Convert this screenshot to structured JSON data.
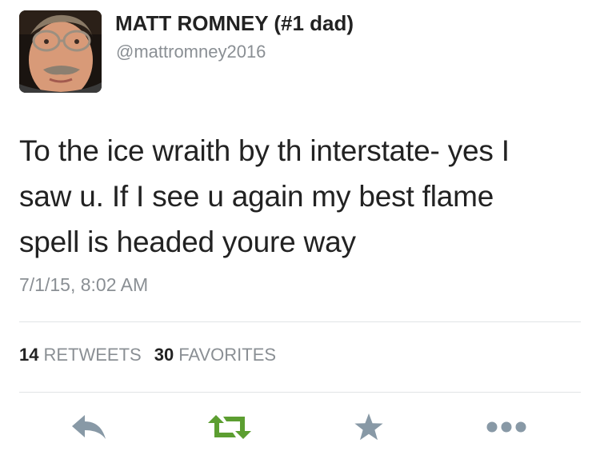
{
  "user": {
    "display_name": "MATT ROMNEY (#1 dad)",
    "handle": "@mattromney2016",
    "avatar": "profile-photo"
  },
  "tweet": {
    "text_lines": [
      "To the ice wraith by th interstate- yes I",
      "saw u. If I see u again my best flame",
      "spell is headed youre way"
    ],
    "timestamp": "7/1/15, 8:02 AM"
  },
  "stats": {
    "retweets_count": "14",
    "retweets_label": "RETWEETS",
    "favorites_count": "30",
    "favorites_label": "FAVORITES"
  },
  "actions": [
    {
      "icon": "reply-icon",
      "color": "#8899a6"
    },
    {
      "icon": "retweet-icon",
      "color": "#5c9e31"
    },
    {
      "icon": "favorite-star-icon",
      "color": "#8899a6"
    },
    {
      "icon": "more-dots-icon",
      "color": "#8899a6"
    }
  ],
  "colors": {
    "text": "#222222",
    "muted": "#8a8f94",
    "divider": "#e1e4e6",
    "retweet_green": "#5c9e31",
    "icon_gray": "#8899a6"
  }
}
